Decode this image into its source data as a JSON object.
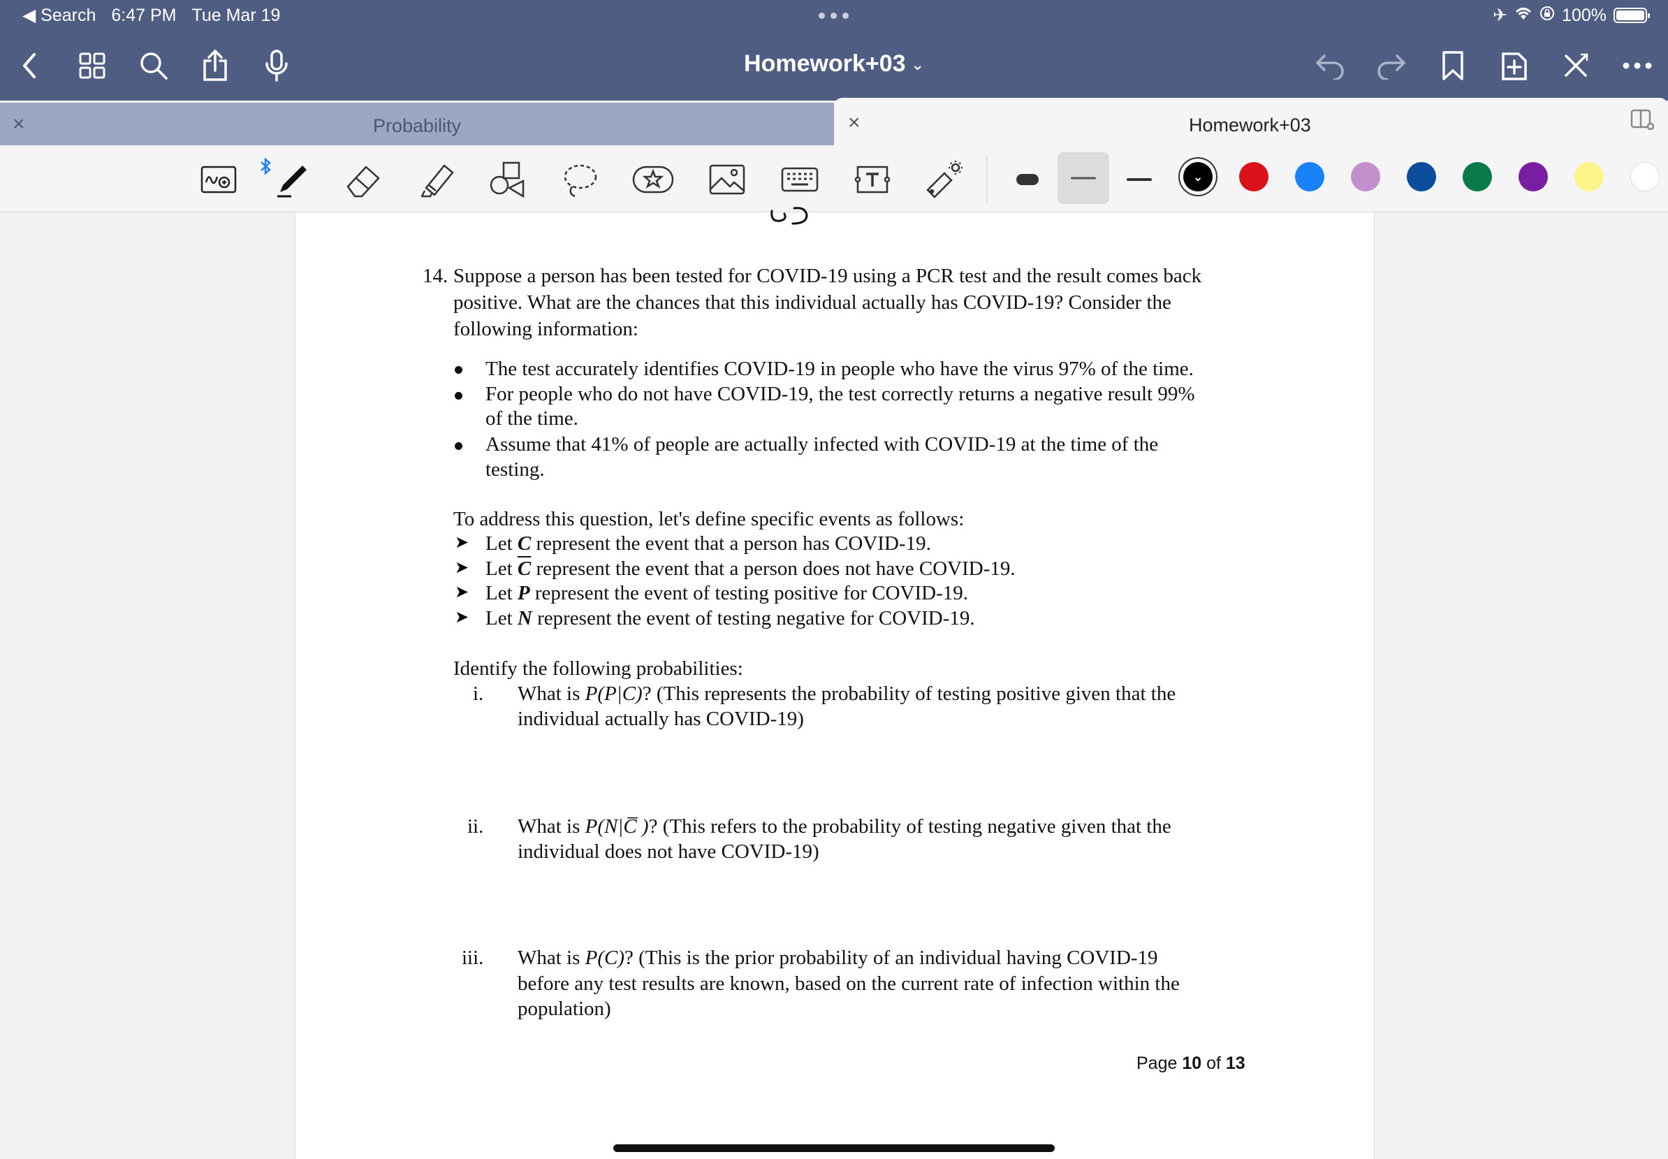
{
  "status_bar": {
    "back_app": "Search",
    "time": "6:47 PM",
    "date": "Tue Mar 19",
    "battery": "100%"
  },
  "nav": {
    "title": "Homework+03"
  },
  "tabs": [
    {
      "label": "Probability",
      "active": false
    },
    {
      "label": "Homework+03",
      "active": true
    }
  ],
  "toolbar": {
    "colors": [
      "#000000",
      "#d9121b",
      "#1a82f7",
      "#c48fcd",
      "#0c4c9c",
      "#0a7a49",
      "#7b1fa2",
      "#fbf58a",
      "#ffffff"
    ],
    "selected_color": "#000000"
  },
  "document": {
    "q_number": "14.",
    "q_line1": "Suppose a person has been tested for COVID-19 using a PCR test and the result comes back",
    "q_line2": "positive. What are the chances that this individual actually has COVID-19? Consider the",
    "q_line3": "following information:",
    "bullets": [
      {
        "line1": "The test accurately identifies COVID-19 in people who have the virus 97% of the time.",
        "line2": ""
      },
      {
        "line1": "For people who do not have COVID-19, the test correctly returns a negative result 99%",
        "line2": "of the time."
      },
      {
        "line1": "Assume that 41% of people are actually infected with COVID-19 at the time of the",
        "line2": "testing."
      }
    ],
    "events_intro": "To address this question, let's define specific events as follows:",
    "events": [
      {
        "pre": "Let ",
        "sym": "C",
        "post": " represent the event that a person has COVID-19.",
        "bar": false
      },
      {
        "pre": "Let ",
        "sym": "C",
        "post": " represent the event that a person does not have COVID-19.",
        "bar": true
      },
      {
        "pre": "Let ",
        "sym": "P",
        "post": " represent the event of testing positive for COVID-19.",
        "bar": false
      },
      {
        "pre": "Let ",
        "sym": "N",
        "post": " represent the event of testing negative for COVID-19.",
        "bar": false
      }
    ],
    "identify_intro": "Identify the following probabilities:",
    "questions": [
      {
        "num": "i.",
        "line1_pre": "What is ",
        "expr": "P(P|C)",
        "line1_post": "? (This represents the probability of testing positive given that the",
        "line2": "individual actually has COVID-19)",
        "line3": ""
      },
      {
        "num": "ii.",
        "line1_pre": "What is ",
        "expr": "P(N|C̅ )",
        "line1_post": "? (This refers to the probability of testing negative given that the",
        "line2": "individual does not have COVID-19)",
        "line3": ""
      },
      {
        "num": "iii.",
        "line1_pre": "What is ",
        "expr": "P(C)",
        "line1_post": "? (This is the prior probability of an individual having COVID-19",
        "line2": "before any test results are known, based on the current rate of infection within the",
        "line3": "population)"
      }
    ],
    "page_label_pre": "Page ",
    "page_current": "10",
    "page_label_mid": " of ",
    "page_total": "13"
  }
}
